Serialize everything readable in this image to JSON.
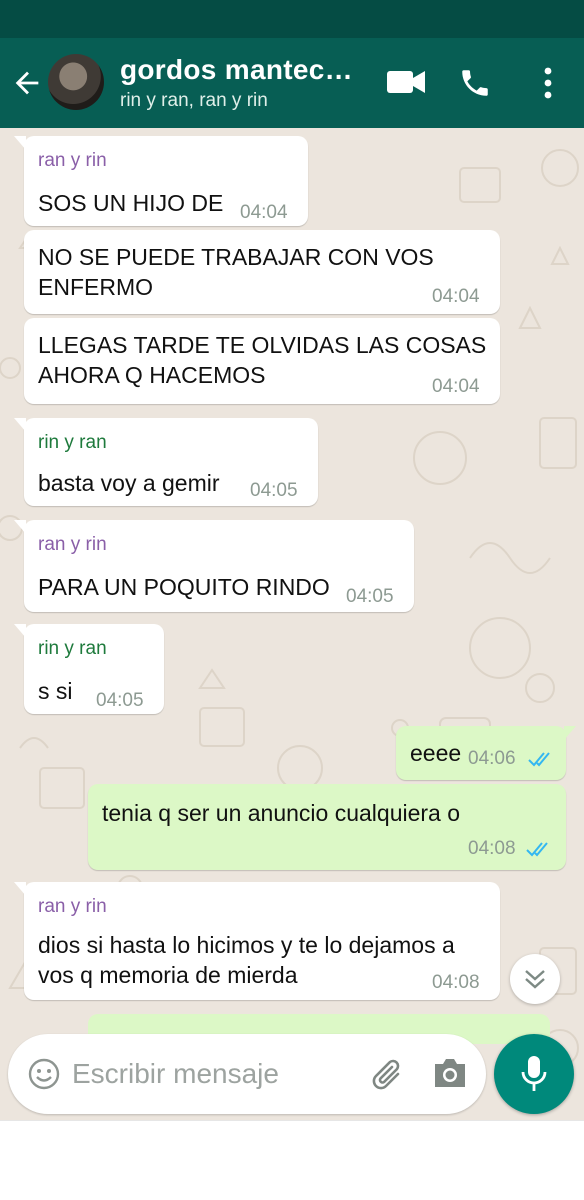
{
  "header": {
    "title": "gordos mantec…",
    "subtitle": "rin y ran, ran y rin",
    "icons": [
      "back-arrow-icon",
      "video-call-icon",
      "phone-icon",
      "more-vert-icon"
    ]
  },
  "colors": {
    "appbar": "#075e54",
    "statusbar": "#054c44",
    "chat_bg": "#ece5dd",
    "incoming": "#ffffff",
    "outgoing": "#dcf8c6",
    "sender_ran_y_rin": "#8a5fa8",
    "sender_rin_y_ran": "#1e7a3c",
    "read_ticks": "#34b7f1",
    "fab": "#00897b"
  },
  "messages": [
    {
      "dir": "in",
      "sender": "ran y rin",
      "lines": [
        "SOS UN HIJO DE"
      ],
      "time": "04:04"
    },
    {
      "dir": "in",
      "sender": "",
      "lines": [
        "NO SE PUEDE TRABAJAR CON VOS",
        "ENFERMO"
      ],
      "time": "04:04"
    },
    {
      "dir": "in",
      "sender": "",
      "lines": [
        "LLEGAS TARDE TE OLVIDAS LAS COSAS",
        "AHORA Q HACEMOS"
      ],
      "time": "04:04"
    },
    {
      "dir": "in",
      "sender": "rin y ran",
      "lines": [
        "basta voy a gemir"
      ],
      "time": "04:05"
    },
    {
      "dir": "in",
      "sender": "ran y rin",
      "lines": [
        "PARA UN POQUITO RINDO"
      ],
      "time": "04:05"
    },
    {
      "dir": "in",
      "sender": "rin y ran",
      "lines": [
        "s si"
      ],
      "time": "04:05"
    },
    {
      "dir": "out",
      "sender": "",
      "lines": [
        "eeee"
      ],
      "time": "04:06",
      "status": "read"
    },
    {
      "dir": "out",
      "sender": "",
      "lines": [
        "tenia q ser un anuncio cualquiera o"
      ],
      "time": "04:08",
      "status": "read"
    },
    {
      "dir": "in",
      "sender": "ran y rin",
      "lines": [
        "dios si hasta lo hicimos y te lo dejamos a",
        "vos q memoria de mierda"
      ],
      "time": "04:08"
    }
  ],
  "composer": {
    "placeholder": "Escribir mensaje",
    "icons": [
      "emoji-icon",
      "attach-icon",
      "camera-icon",
      "mic-icon"
    ]
  }
}
